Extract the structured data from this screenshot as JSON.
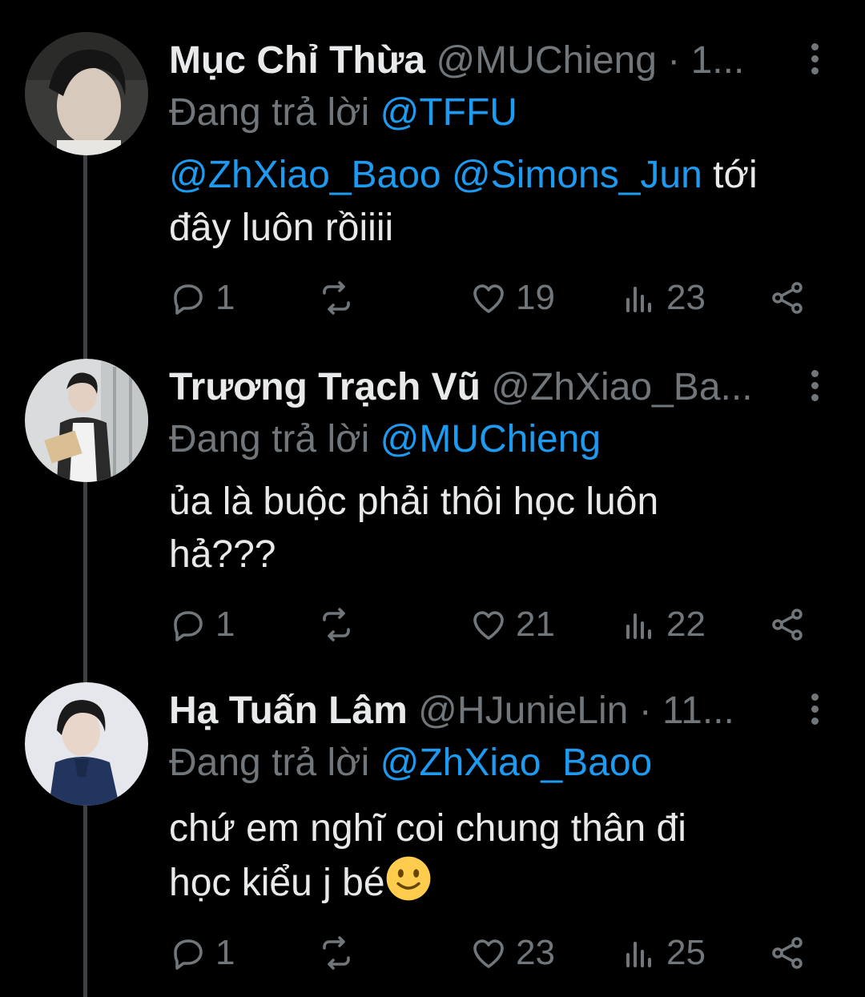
{
  "tweets": [
    {
      "name": "Mục Chỉ Thừa",
      "handle": "@MUChieng",
      "separator": "·",
      "time": "1...",
      "reply_prefix": "Đang trả lời",
      "reply_to": "@TFFU",
      "mentions": [
        "@ZhXiao_Baoo",
        "@Simons_Jun"
      ],
      "text": "tới đây luôn rồiiii",
      "counts": {
        "reply": "1",
        "retweet": "",
        "like": "19",
        "views": "23"
      }
    },
    {
      "name": "Trương Trạch Vũ",
      "handle": "@ZhXiao_Ba...",
      "reply_prefix": "Đang trả lời",
      "reply_to": "@MUChieng",
      "text_line1": "ủa là buộc phải thôi học luôn",
      "text_line2": "hả???",
      "counts": {
        "reply": "1",
        "retweet": "",
        "like": "21",
        "views": "22"
      }
    },
    {
      "name": "Hạ Tuấn Lâm",
      "handle": "@HJunieLin",
      "separator": "·",
      "time": "11...",
      "reply_prefix": "Đang trả lời",
      "reply_to": "@ZhXiao_Baoo",
      "text_line1": "chứ em nghĩ coi chung thân đi",
      "text_line2": "học kiểu j bé",
      "emoji": "slightly-smiling-face-emoji",
      "counts": {
        "reply": "1",
        "retweet": "",
        "like": "23",
        "views": "25"
      }
    }
  ],
  "icons": {
    "reply": "reply-icon",
    "retweet": "retweet-icon",
    "like": "heart-icon",
    "views": "views-icon",
    "share": "share-icon",
    "more": "more-vertical-icon"
  },
  "colors": {
    "background": "#000000",
    "text": "#e7e9ea",
    "secondary": "#71767b",
    "link": "#1d9bf0",
    "thread_line": "#3e4144"
  }
}
